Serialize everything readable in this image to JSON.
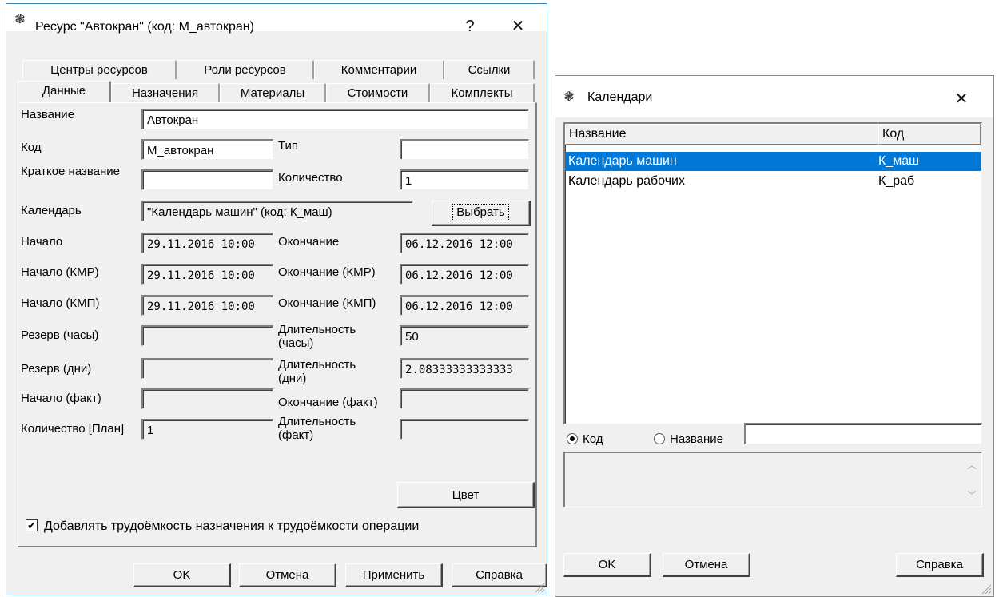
{
  "resource_dialog": {
    "title": "Ресурс \"Автокран\" (код: М_автокран)",
    "help_glyph": "?",
    "close_glyph": "✕",
    "tabs_row1": [
      "Центры ресурсов",
      "Роли ресурсов",
      "Комментарии",
      "Ссылки"
    ],
    "tabs_row2": [
      "Данные",
      "Назначения",
      "Материалы",
      "Стоимости",
      "Комплекты"
    ],
    "active_tab": "Данные",
    "labels": {
      "name": "Название",
      "code": "Код",
      "type": "Тип",
      "short_name": "Краткое название",
      "quantity": "Количество",
      "calendar": "Календарь",
      "start": "Начало",
      "end": "Окончание",
      "start_kmr": "Начало (КМР)",
      "end_kmr": "Окончание (КМР)",
      "start_kmp": "Начало (КМП)",
      "end_kmp": "Окончание (КМП)",
      "reserve_hours": "Резерв (часы)",
      "duration_hours": "Длительность (часы)",
      "reserve_days": "Резерв (дни)",
      "duration_days": "Длительность (дни)",
      "start_fact": "Начало (факт)",
      "end_fact": "Окончание (факт)",
      "quantity_plan": "Количество [План]",
      "duration_fact": "Длительность (факт)"
    },
    "values": {
      "name": "Автокран",
      "code": "М_автокран",
      "type": "",
      "short_name": "",
      "quantity": "1",
      "calendar": "\"Календарь машин\" (код: К_маш)",
      "start": "29.11.2016  10:00",
      "end": "06.12.2016  12:00",
      "start_kmr": "29.11.2016  10:00",
      "end_kmr": "06.12.2016  12:00",
      "start_kmp": "29.11.2016  10:00",
      "end_kmp": "06.12.2016  12:00",
      "reserve_hours": "",
      "duration_hours": "50",
      "reserve_days": "",
      "duration_days": "2.08333333333333",
      "start_fact": "",
      "end_fact": "",
      "quantity_plan": "1",
      "duration_fact": ""
    },
    "choose_button": "Выбрать",
    "color_button": "Цвет",
    "checkbox_label": "Добавлять трудоёмкость назначения к трудоёмкости операции",
    "checkbox_checked": true,
    "checkbox_glyph": "✔",
    "buttons": {
      "ok": "OK",
      "cancel": "Отмена",
      "apply": "Применить",
      "help": "Справка"
    }
  },
  "calendars_dialog": {
    "title": "Календари",
    "close_glyph": "✕",
    "columns": [
      "Название",
      "Код"
    ],
    "rows": [
      {
        "name": "Календарь машин",
        "code": "К_маш",
        "selected": true
      },
      {
        "name": "Календарь рабочих",
        "code": "К_раб",
        "selected": false
      }
    ],
    "search_by": {
      "code_label": "Код",
      "name_label": "Название",
      "selected": "code",
      "search_value": ""
    },
    "buttons": {
      "ok": "OK",
      "cancel": "Отмена",
      "help": "Справка"
    }
  },
  "colors": {
    "selection": "#0078d7",
    "window_bg": "#f0f0f0",
    "border_accent": "#3c7fb1"
  },
  "icons": [
    "app-bug-icon",
    "help-icon",
    "close-icon",
    "checkmark-icon",
    "scroll-up-icon",
    "scroll-down-icon",
    "size-grip-icon"
  ]
}
